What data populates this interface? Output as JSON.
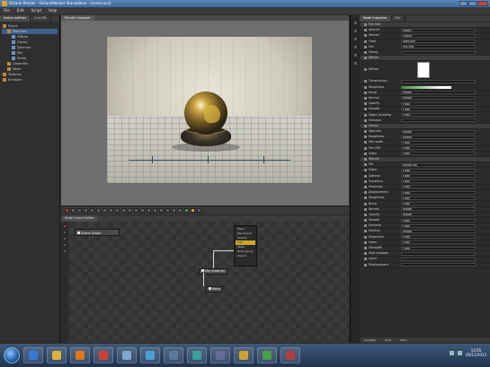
{
  "window": {
    "title": "Octane Render - OctaneRender Standalone - [scene.ocs]",
    "controls": [
      "minimize",
      "maximize",
      "close"
    ]
  },
  "menubar": {
    "items": [
      "File",
      "Edit",
      "Script",
      "Help"
    ]
  },
  "left_panel": {
    "tabs": [
      "Scene outliner",
      "Live DB"
    ],
    "tree": [
      {
        "label": "Scene",
        "depth": 0
      },
      {
        "label": "Materials",
        "depth": 1
      },
      {
        "label": "Diffuse",
        "depth": 2
      },
      {
        "label": "Glossy",
        "depth": 2
      },
      {
        "label": "Specular",
        "depth": 2
      },
      {
        "label": "Mix",
        "depth": 2
      },
      {
        "label": "Portal",
        "depth": 2
      },
      {
        "label": "Geometry",
        "depth": 1
      },
      {
        "label": "Mesh",
        "depth": 1
      },
      {
        "label": "Textures",
        "depth": 0
      },
      {
        "label": "Emission",
        "depth": 0
      }
    ]
  },
  "viewport": {
    "tab": "Render viewport"
  },
  "node_panel": {
    "tabs": [
      "Node Graph Editor"
    ],
    "group_label": "Scene Graph",
    "context_menu": [
      "Mesh",
      "Placement",
      "Scatter",
      "Add",
      "Paste",
      "Node group",
      "Import..."
    ],
    "context_selected_index": 3,
    "nodes": [
      {
        "name": "Mix material"
      },
      {
        "name": "Mesh"
      }
    ]
  },
  "right_panel": {
    "tabs": [
      "Node inspector",
      "Mix"
    ],
    "rows": [
      {
        "type": "header",
        "label": "Mix mat"
      },
      {
        "type": "field",
        "label": "Amount",
        "value": "Mixed"
      },
      {
        "type": "field",
        "label": "Texture",
        "value": "Glossy"
      },
      {
        "type": "field",
        "label": "Float",
        "value": "Specular"
      },
      {
        "type": "field",
        "label": "Mix",
        "value": "Mix Mat"
      },
      {
        "type": "field",
        "label": "Glossy",
        "value": ""
      },
      {
        "type": "header",
        "label": "Diffuse"
      },
      {
        "type": "color",
        "label": "Diffuse"
      },
      {
        "type": "field",
        "label": "Transmission",
        "value": ""
      },
      {
        "type": "bar",
        "label": "Roughness",
        "value": 0.4
      },
      {
        "type": "field",
        "label": "Bump",
        "value": "Image"
      },
      {
        "type": "field",
        "label": "Normal",
        "value": "Image"
      },
      {
        "type": "field",
        "label": "Opacity",
        "value": "Float"
      },
      {
        "type": "field",
        "label": "Smooth",
        "value": "Float"
      },
      {
        "type": "field",
        "label": "Edges rounding",
        "value": "Float"
      },
      {
        "type": "field",
        "label": "Emission",
        "value": ""
      },
      {
        "type": "header",
        "label": "Glossy"
      },
      {
        "type": "field",
        "label": "Specular",
        "value": "Image"
      },
      {
        "type": "field",
        "label": "Roughness",
        "value": "Image"
      },
      {
        "type": "field",
        "label": "Film width",
        "value": "Float"
      },
      {
        "type": "field",
        "label": "Film IOR",
        "value": "Float"
      },
      {
        "type": "field",
        "label": "Index",
        "value": "Float"
      },
      {
        "type": "header",
        "label": "Texture"
      },
      {
        "type": "field",
        "label": "File",
        "value": "Image file"
      },
      {
        "type": "field",
        "label": "Power",
        "value": "Float"
      },
      {
        "type": "field",
        "label": "Gamma",
        "value": "Float"
      },
      {
        "type": "field",
        "label": "Transform",
        "value": "Float"
      },
      {
        "type": "field",
        "label": "Projection",
        "value": "Float"
      },
      {
        "type": "field",
        "label": "Displacement",
        "value": "Float"
      },
      {
        "type": "field",
        "label": "Roughness",
        "value": "Float"
      },
      {
        "type": "field",
        "label": "Bump",
        "value": "Float"
      },
      {
        "type": "field",
        "label": "Normal",
        "value": "Image"
      },
      {
        "type": "field",
        "label": "Opacity",
        "value": "Image"
      },
      {
        "type": "field",
        "label": "Smooth",
        "value": "Float"
      },
      {
        "type": "field",
        "label": "Emission",
        "value": "Float"
      },
      {
        "type": "field",
        "label": "Medium",
        "value": "Image"
      },
      {
        "type": "field",
        "label": "Dispersion",
        "value": "Float"
      },
      {
        "type": "field",
        "label": "Index",
        "value": "Float"
      },
      {
        "type": "field",
        "label": "Filmwidth",
        "value": "Float"
      },
      {
        "type": "field",
        "label": "Fake shadows",
        "value": ""
      },
      {
        "type": "field",
        "label": "Layer",
        "value": ""
      },
      {
        "type": "field",
        "label": "Displacement",
        "value": ""
      }
    ],
    "status": [
      "Samples",
      "Time",
      "Mem"
    ]
  },
  "taskbar": {
    "apps": [
      {
        "icon": "ie-icon",
        "color": "#2f7bd6"
      },
      {
        "icon": "folder-icon",
        "color": "#e0b040"
      },
      {
        "icon": "media-player-icon",
        "color": "#e07820"
      },
      {
        "icon": "chrome-icon",
        "color": "#d04030"
      },
      {
        "icon": "app-icon",
        "color": "#7fa7d0"
      },
      {
        "icon": "paint-icon",
        "color": "#49a0d8"
      },
      {
        "icon": "app-icon",
        "color": "#5a7a9a"
      },
      {
        "icon": "app-icon",
        "color": "#3aa0a0"
      },
      {
        "icon": "app-icon",
        "color": "#6a6a9a"
      },
      {
        "icon": "octane-icon",
        "color": "#d0a030"
      },
      {
        "icon": "app-icon",
        "color": "#4aa04a"
      },
      {
        "icon": "app-icon",
        "color": "#b04040"
      }
    ],
    "time": "13:05",
    "date": "05/11/2013"
  }
}
